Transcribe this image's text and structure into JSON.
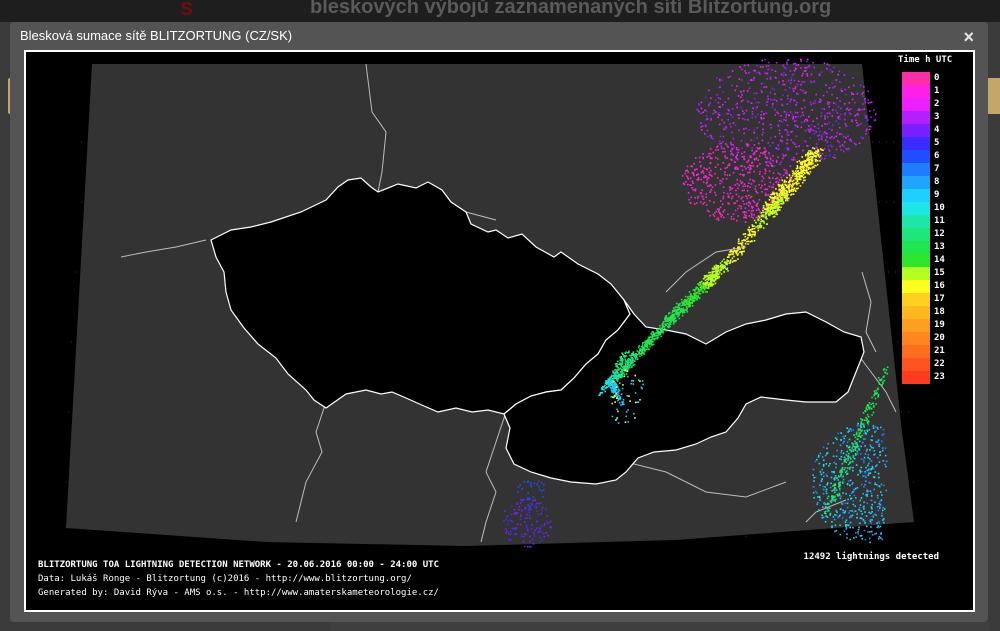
{
  "page": {
    "background_title": "bleskových výbojů zaznamenaných sítí Blitzortung.org"
  },
  "dialog": {
    "title": "Blesková sumace sítě BLITZORTUNG (CZ/SK)",
    "close_symbol": "×"
  },
  "map": {
    "footer_line1": "BLITZORTUNG TOA LIGHTNING DETECTION NETWORK - 20.06.2016  00:00 - 24:00 UTC",
    "footer_line2": "Data: Lukáš Ronge - Blitzortung (c)2016  -  http://www.blitzortung.org/",
    "footer_line3": "Generated by: David Rýva - AMS o.s.  -  http://www.amaterskameteorologie.cz/",
    "count_text": "12492 lightnings detected",
    "legend": {
      "title": "Time h UTC",
      "items": [
        {
          "label": "0",
          "color": "#ff2ea8"
        },
        {
          "label": "1",
          "color": "#ff1fe6"
        },
        {
          "label": "2",
          "color": "#ee1fff"
        },
        {
          "label": "3",
          "color": "#b31fff"
        },
        {
          "label": "4",
          "color": "#7a1fff"
        },
        {
          "label": "5",
          "color": "#3a2bff"
        },
        {
          "label": "6",
          "color": "#1f4dff"
        },
        {
          "label": "7",
          "color": "#1f7bff"
        },
        {
          "label": "8",
          "color": "#1fa4ff"
        },
        {
          "label": "9",
          "color": "#1fcfff"
        },
        {
          "label": "10",
          "color": "#1fe6e6"
        },
        {
          "label": "11",
          "color": "#1fe6a8"
        },
        {
          "label": "12",
          "color": "#1fe67a"
        },
        {
          "label": "13",
          "color": "#1fe64d"
        },
        {
          "label": "14",
          "color": "#2ee62e"
        },
        {
          "label": "15",
          "color": "#b3ff1f"
        },
        {
          "label": "16",
          "color": "#ffff1f"
        },
        {
          "label": "17",
          "color": "#ffd11f"
        },
        {
          "label": "18",
          "color": "#ffb81f"
        },
        {
          "label": "19",
          "color": "#ff9f1f"
        },
        {
          "label": "20",
          "color": "#ff861f"
        },
        {
          "label": "21",
          "color": "#ff6d1f"
        },
        {
          "label": "22",
          "color": "#ff541f"
        },
        {
          "label": "23",
          "color": "#ff3b1f"
        }
      ]
    }
  }
}
